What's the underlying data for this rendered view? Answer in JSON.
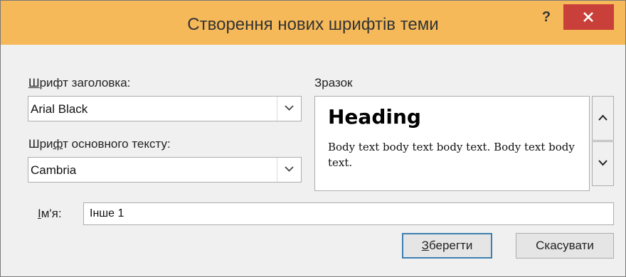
{
  "window": {
    "title": "Створення нових шрифтів теми",
    "help_label": "?"
  },
  "heading_font": {
    "label_u": "Ш",
    "label_rest": "рифт заголовка:",
    "value": "Arial Black"
  },
  "body_font": {
    "label_pre": "Шри",
    "label_u": "ф",
    "label_rest": "т основного тексту:",
    "value": "Cambria"
  },
  "sample": {
    "label": "Зразок",
    "heading": "Heading",
    "body": "Body text body text body text. Body text body text."
  },
  "name": {
    "label_u": "І",
    "label_rest": "м'я:",
    "value": "Інше 1"
  },
  "buttons": {
    "save_u": "З",
    "save_rest": "берегти",
    "cancel": "Скасувати"
  },
  "colors": {
    "titlebar": "#f5b95a",
    "close": "#c9403a",
    "default_button_border": "#3c7fb1"
  },
  "icons": [
    "help-icon",
    "close-icon",
    "chevron-down-icon",
    "chevron-up-icon"
  ]
}
